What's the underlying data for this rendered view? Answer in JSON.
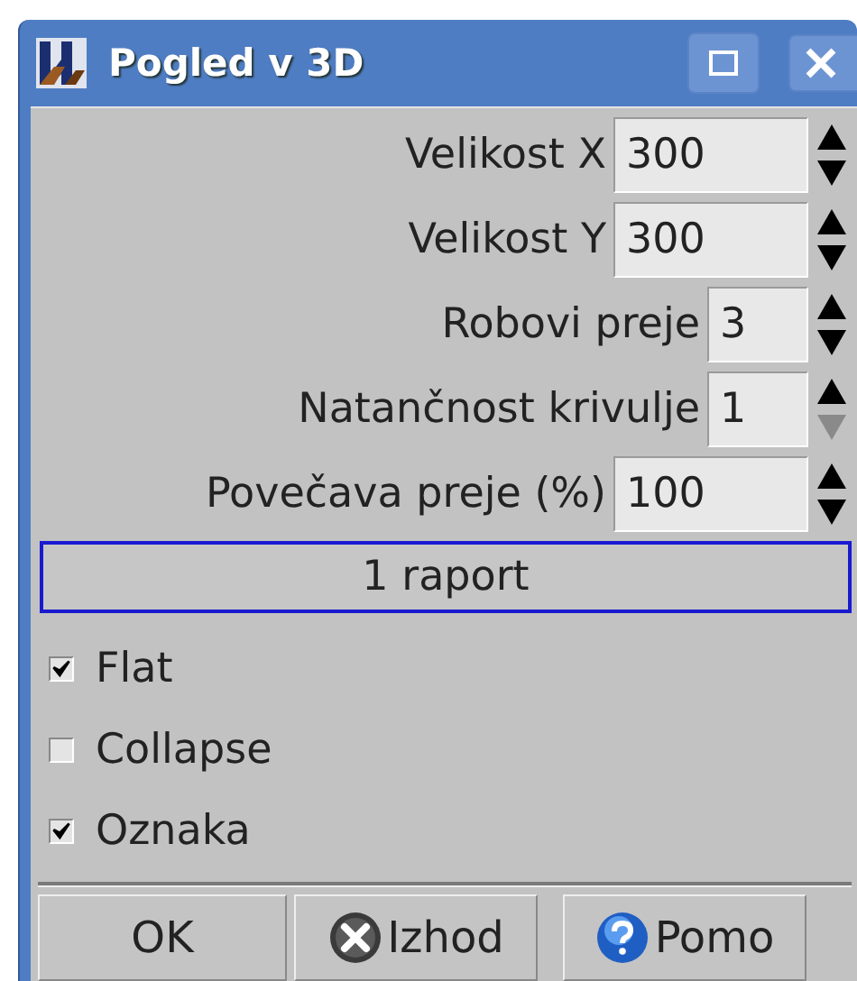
{
  "window": {
    "title": "Pogled v 3D"
  },
  "fields": [
    {
      "label": "Velikost X",
      "value": "300",
      "down_disabled": false
    },
    {
      "label": "Velikost Y",
      "value": "300",
      "down_disabled": false
    },
    {
      "label": "Robovi preje",
      "value": "3",
      "down_disabled": false
    },
    {
      "label": "Natančnost krivulje",
      "value": "1",
      "down_disabled": true
    },
    {
      "label": "Povečava preje (%)",
      "value": "100",
      "down_disabled": false
    }
  ],
  "report_button": {
    "label": "1 raport"
  },
  "checkboxes": [
    {
      "label": "Flat",
      "checked": true
    },
    {
      "label": "Collapse",
      "checked": false
    },
    {
      "label": "Oznaka",
      "checked": true
    }
  ],
  "buttons": [
    {
      "label": "OK",
      "kind": "plain"
    },
    {
      "label": "Izhod",
      "kind": "cancel"
    },
    {
      "label": "Pomo",
      "kind": "help"
    }
  ]
}
